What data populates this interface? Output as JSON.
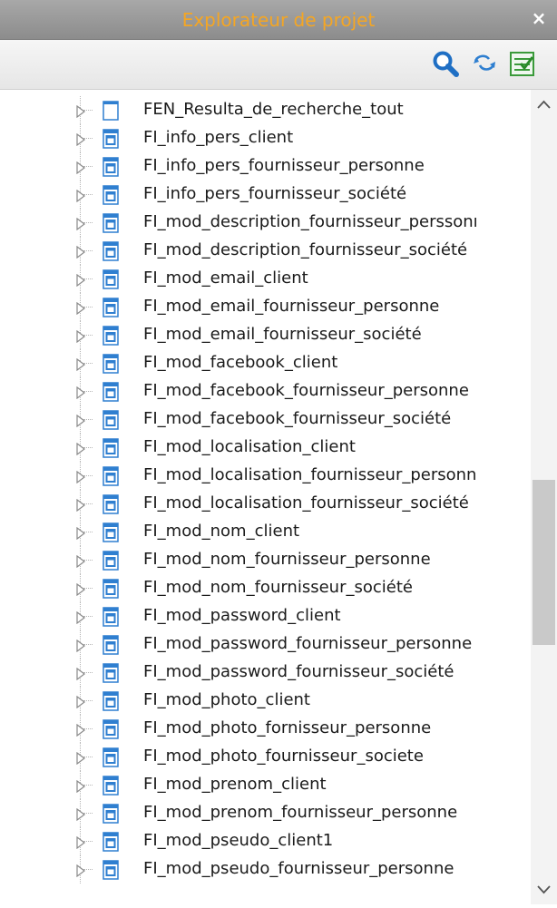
{
  "panel": {
    "title": "Explorateur de projet",
    "close_label": "×"
  },
  "toolbar": {
    "buttons": [
      {
        "name": "search",
        "icon": "search-icon"
      },
      {
        "name": "sync",
        "icon": "sync-arrows-icon"
      },
      {
        "name": "checklist",
        "icon": "checklist-icon"
      }
    ]
  },
  "colors": {
    "title_text": "#f5a623",
    "titlebar_bg": "#969696",
    "icon_blue": "#2f7fd0"
  },
  "tree": {
    "items": [
      {
        "label": "FEN_Resulta_de_recherche_tout",
        "icon": "window-icon"
      },
      {
        "label": "FI_info_pers_client",
        "icon": "internal-window-icon"
      },
      {
        "label": "FI_info_pers_fournisseur_personne",
        "icon": "internal-window-icon"
      },
      {
        "label": "FI_info_pers_fournisseur_société",
        "icon": "internal-window-icon"
      },
      {
        "label": "FI_mod_description_fournisseur_perssonı",
        "icon": "internal-window-icon"
      },
      {
        "label": "FI_mod_description_fournisseur_société",
        "icon": "internal-window-icon"
      },
      {
        "label": "FI_mod_email_client",
        "icon": "internal-window-icon"
      },
      {
        "label": "FI_mod_email_fournisseur_personne",
        "icon": "internal-window-icon"
      },
      {
        "label": "FI_mod_email_fournisseur_société",
        "icon": "internal-window-icon"
      },
      {
        "label": "FI_mod_facebook_client",
        "icon": "internal-window-icon"
      },
      {
        "label": "FI_mod_facebook_fournisseur_personne",
        "icon": "internal-window-icon"
      },
      {
        "label": "FI_mod_facebook_fournisseur_société",
        "icon": "internal-window-icon"
      },
      {
        "label": "FI_mod_localisation_client",
        "icon": "internal-window-icon"
      },
      {
        "label": "FI_mod_localisation_fournisseur_personn",
        "icon": "internal-window-icon"
      },
      {
        "label": "FI_mod_localisation_fournisseur_société",
        "icon": "internal-window-icon"
      },
      {
        "label": "FI_mod_nom_client",
        "icon": "internal-window-icon"
      },
      {
        "label": "FI_mod_nom_fournisseur_personne",
        "icon": "internal-window-icon"
      },
      {
        "label": "FI_mod_nom_fournisseur_société",
        "icon": "internal-window-icon"
      },
      {
        "label": "FI_mod_password_client",
        "icon": "internal-window-icon"
      },
      {
        "label": "FI_mod_password_fournisseur_personne",
        "icon": "internal-window-icon"
      },
      {
        "label": "FI_mod_password_fournisseur_société",
        "icon": "internal-window-icon"
      },
      {
        "label": "FI_mod_photo_client",
        "icon": "internal-window-icon"
      },
      {
        "label": "FI_mod_photo_fornisseur_personne",
        "icon": "internal-window-icon"
      },
      {
        "label": "FI_mod_photo_fournisseur_societe",
        "icon": "internal-window-icon"
      },
      {
        "label": "FI_mod_prenom_client",
        "icon": "internal-window-icon"
      },
      {
        "label": "FI_mod_prenom_fournisseur_personne",
        "icon": "internal-window-icon"
      },
      {
        "label": "FI_mod_pseudo_client1",
        "icon": "internal-window-icon"
      },
      {
        "label": "FI_mod_pseudo_fournisseur_personne",
        "icon": "internal-window-icon"
      }
    ]
  }
}
